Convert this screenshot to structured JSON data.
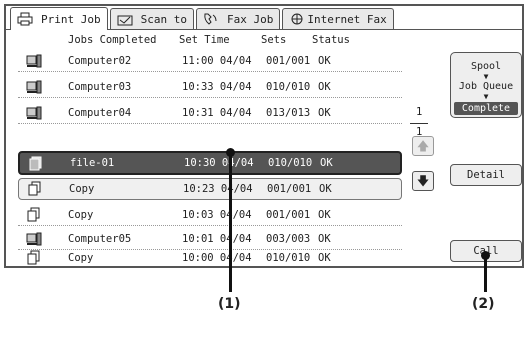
{
  "tabs": [
    {
      "label": "Print Job",
      "icon": "printer-icon",
      "active": true
    },
    {
      "label": "Scan to",
      "icon": "scanner-icon",
      "active": false
    },
    {
      "label": "Fax Job",
      "icon": "fax-icon",
      "active": false
    },
    {
      "label": "Internet Fax",
      "icon": "internet-fax-icon",
      "active": false
    }
  ],
  "table": {
    "headers": [
      "Jobs Completed",
      "Set Time",
      "Sets",
      "Status"
    ],
    "rows": [
      {
        "icon": "computer-icon",
        "name": "Computer02",
        "time": "11:00 04/04",
        "sets": "001/001",
        "status": "OK"
      },
      {
        "icon": "computer-icon",
        "name": "Computer03",
        "time": "10:33 04/04",
        "sets": "010/010",
        "status": "OK"
      },
      {
        "icon": "computer-icon",
        "name": "Computer04",
        "time": "10:31 04/04",
        "sets": "013/013",
        "status": "OK"
      },
      {
        "icon": "file-icon",
        "name": "file-01",
        "time": "10:30 04/04",
        "sets": "010/010",
        "status": "OK",
        "selected": true
      },
      {
        "icon": "copy-icon",
        "name": "Copy",
        "time": "10:23 04/04",
        "sets": "001/001",
        "status": "OK"
      },
      {
        "icon": "copy-icon",
        "name": "Copy",
        "time": "10:03 04/04",
        "sets": "001/001",
        "status": "OK"
      },
      {
        "icon": "computer-icon",
        "name": "Computer05",
        "time": "10:01 04/04",
        "sets": "003/003",
        "status": "OK"
      },
      {
        "icon": "copy-icon",
        "name": "Copy",
        "time": "10:00 04/04",
        "sets": "010/010",
        "status": "OK"
      }
    ]
  },
  "queue_selector": {
    "items": [
      "Spool",
      "Job Queue",
      "Complete"
    ],
    "selected": "Complete"
  },
  "pagination": {
    "current": "1",
    "total": "1"
  },
  "buttons": {
    "detail": "Detail",
    "call": "Call"
  },
  "callouts": {
    "one": "(1)",
    "two": "(2)"
  }
}
